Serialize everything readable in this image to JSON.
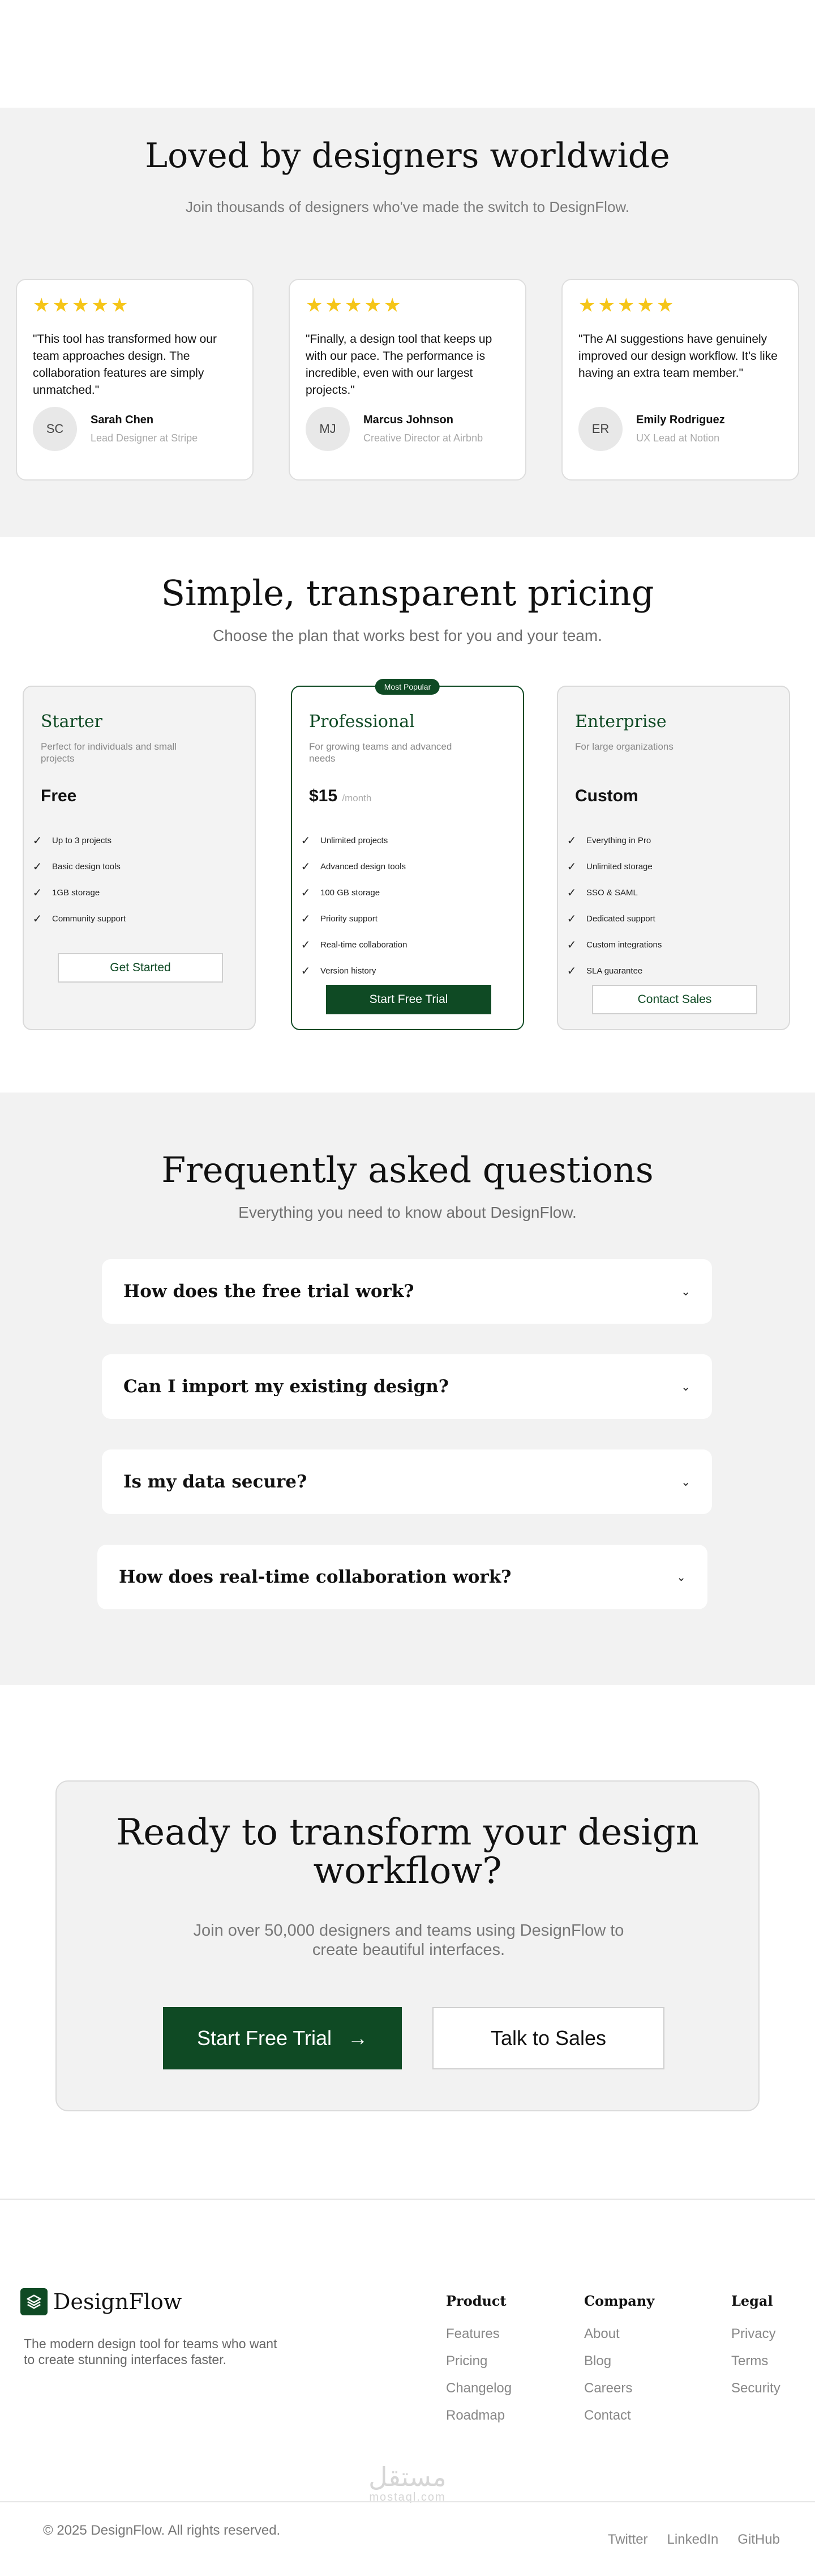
{
  "testimonials": {
    "title": "Loved by designers worldwide",
    "subtitle": "Join thousands of designers who've made the switch to DesignFlow.",
    "items": [
      {
        "quote": "\"This tool has transformed how our team approaches design. The collaboration features are simply unmatched.\"",
        "initials": "SC",
        "name": "Sarah Chen",
        "role": "Lead Designer at Stripe",
        "rating": 5
      },
      {
        "quote": "\"Finally, a design tool that keeps up with our pace. The performance is incredible, even with our largest projects.\"",
        "initials": "MJ",
        "name": "Marcus Johnson",
        "role": "Creative Director at Airbnb",
        "rating": 5
      },
      {
        "quote": "\"The AI suggestions have genuinely improved our design workflow. It's like having an extra team member.\"",
        "initials": "ER",
        "name": "Emily Rodriguez",
        "role": "UX Lead at Notion",
        "rating": 5
      }
    ]
  },
  "pricing": {
    "title": "Simple, transparent pricing",
    "subtitle": "Choose the plan that works best for you and your team.",
    "plans": [
      {
        "name": "Starter",
        "desc": "Perfect for individuals and small projects",
        "price": "Free",
        "per": "",
        "badge": "",
        "cta": "Get Started",
        "features": [
          "Up to 3 projects",
          "Basic design tools",
          "1GB storage",
          "Community support"
        ]
      },
      {
        "name": "Professional",
        "desc": "For growing teams and advanced needs",
        "price": "$15",
        "per": "/month",
        "badge": "Most Popular",
        "cta": "Start Free Trial",
        "features": [
          "Unlimited projects",
          "Advanced design tools",
          "100 GB storage",
          "Priority support",
          "Real-time collaboration",
          "Version history"
        ]
      },
      {
        "name": "Enterprise",
        "desc": "For large organizations",
        "price": "Custom",
        "per": "",
        "badge": "",
        "cta": "Contact Sales",
        "features": [
          "Everything in Pro",
          "Unlimited storage",
          "SSO & SAML",
          "Dedicated support",
          "Custom integrations",
          "SLA guarantee"
        ]
      }
    ]
  },
  "faq": {
    "title": "Frequently asked questions",
    "subtitle": "Everything you need to know about DesignFlow.",
    "items": [
      {
        "q": "How does the free trial work?"
      },
      {
        "q": "Can I import my existing design?"
      },
      {
        "q": "Is my data secure?"
      },
      {
        "q": "How does real-time collaboration work?"
      }
    ]
  },
  "cta": {
    "title": "Ready to transform your design workflow?",
    "subtitle": "Join over 50,000 designers and teams using DesignFlow to create beautiful interfaces.",
    "primary": "Start Free Trial",
    "primary_icon": "→",
    "secondary": "Talk to Sales"
  },
  "footer": {
    "brand": "DesignFlow",
    "tagline": "The modern design tool for teams who want to create stunning interfaces faster.",
    "columns": [
      {
        "title": "Product",
        "links": [
          "Features",
          "Pricing",
          "Changelog",
          "Roadmap"
        ]
      },
      {
        "title": "Company",
        "links": [
          "About",
          "Blog",
          "Careers",
          "Contact"
        ]
      },
      {
        "title": "Legal",
        "links": [
          "Privacy",
          "Terms",
          "Security"
        ]
      }
    ],
    "copyright": "© 2025 DesignFlow. All rights reserved.",
    "social": [
      "Twitter",
      "LinkedIn",
      "GitHub"
    ],
    "watermark": {
      "arabic": "مستقل",
      "latin": "mostaql.com"
    }
  },
  "colors": {
    "brand": "#0f4a24",
    "star": "#f5c518",
    "section_bg": "#f2f2f2"
  },
  "icons": {
    "star": "star-icon",
    "check": "check-icon",
    "chevron": "chevron-down-icon",
    "arrow": "arrow-right-icon",
    "logo": "layers-icon"
  }
}
